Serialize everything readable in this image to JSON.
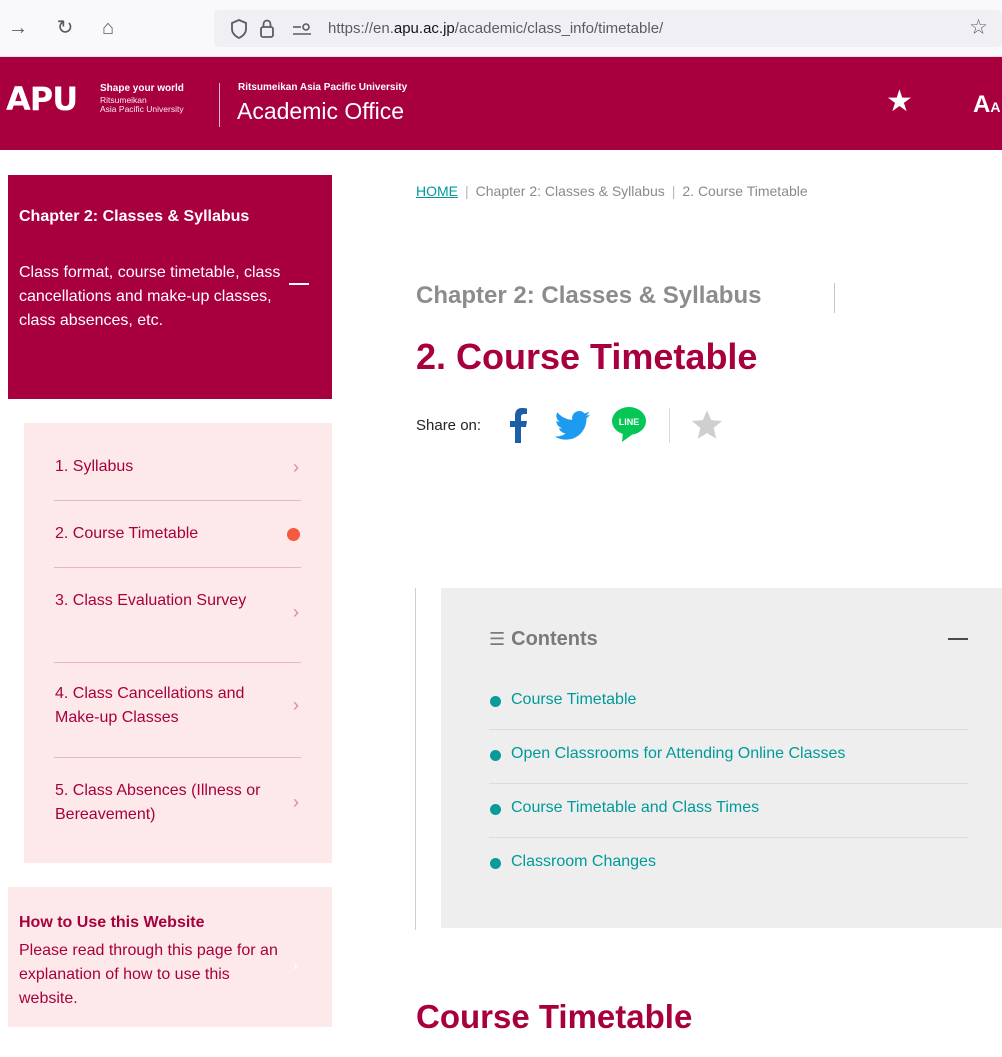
{
  "browser": {
    "url_prefix": "https://en.",
    "url_domain": "apu.ac.jp",
    "url_path": "/academic/class_info/timetable/"
  },
  "header": {
    "logo": "APU",
    "tagline": "Shape your world",
    "logo_sub1": "Ritsumeikan",
    "logo_sub2": "Asia Pacific University",
    "university": "Ritsumeikan Asia Pacific University",
    "office": "Academic Office",
    "font_control_large": "A",
    "font_control_small": "A"
  },
  "sidebar": {
    "chapter_title": "Chapter 2: Classes & Syllabus",
    "chapter_desc": "Class format, course timetable, class cancellations and make-up classes, class absences, etc.",
    "items": [
      {
        "label": "1. Syllabus",
        "current": false
      },
      {
        "label": "2. Course Timetable",
        "current": true
      },
      {
        "label": "3. Class Evaluation Survey",
        "current": false
      },
      {
        "label": "4. Class Cancellations and Make-up Classes",
        "current": false
      },
      {
        "label": "5. Class Absences (Illness or Bereavement)",
        "current": false
      }
    ],
    "howto_title": "How to Use this Website",
    "howto_desc": "Please read through this page for an explanation of how to use this website."
  },
  "breadcrumb": {
    "home": "HOME",
    "chapter": "Chapter 2: Classes & Syllabus",
    "page": "2. Course Timetable",
    "separator": "|"
  },
  "main": {
    "chapter_label": "Chapter 2: Classes & Syllabus",
    "page_title": "2. Course Timetable",
    "share_label": "Share on:",
    "line_label": "LINE",
    "toc_title": "Contents",
    "toc_items": [
      "Course Timetable",
      "Open Classrooms for Attending Online Classes",
      "Course Timetable and Class Times",
      "Classroom Changes"
    ],
    "section_title": "Course Timetable"
  },
  "colors": {
    "brand": "#a8003e",
    "accent_teal": "#009a9a",
    "subnav_bg": "#fde9e9",
    "current_dot": "#f35a3e"
  },
  "icons": [
    "back-arrow-icon",
    "reload-icon",
    "home-icon",
    "shield-icon",
    "lock-icon",
    "permissions-icon",
    "bookmark-star-icon",
    "favorite-star-icon",
    "facebook-icon",
    "twitter-icon",
    "line-icon",
    "list-icon",
    "chevron-right-icon"
  ]
}
